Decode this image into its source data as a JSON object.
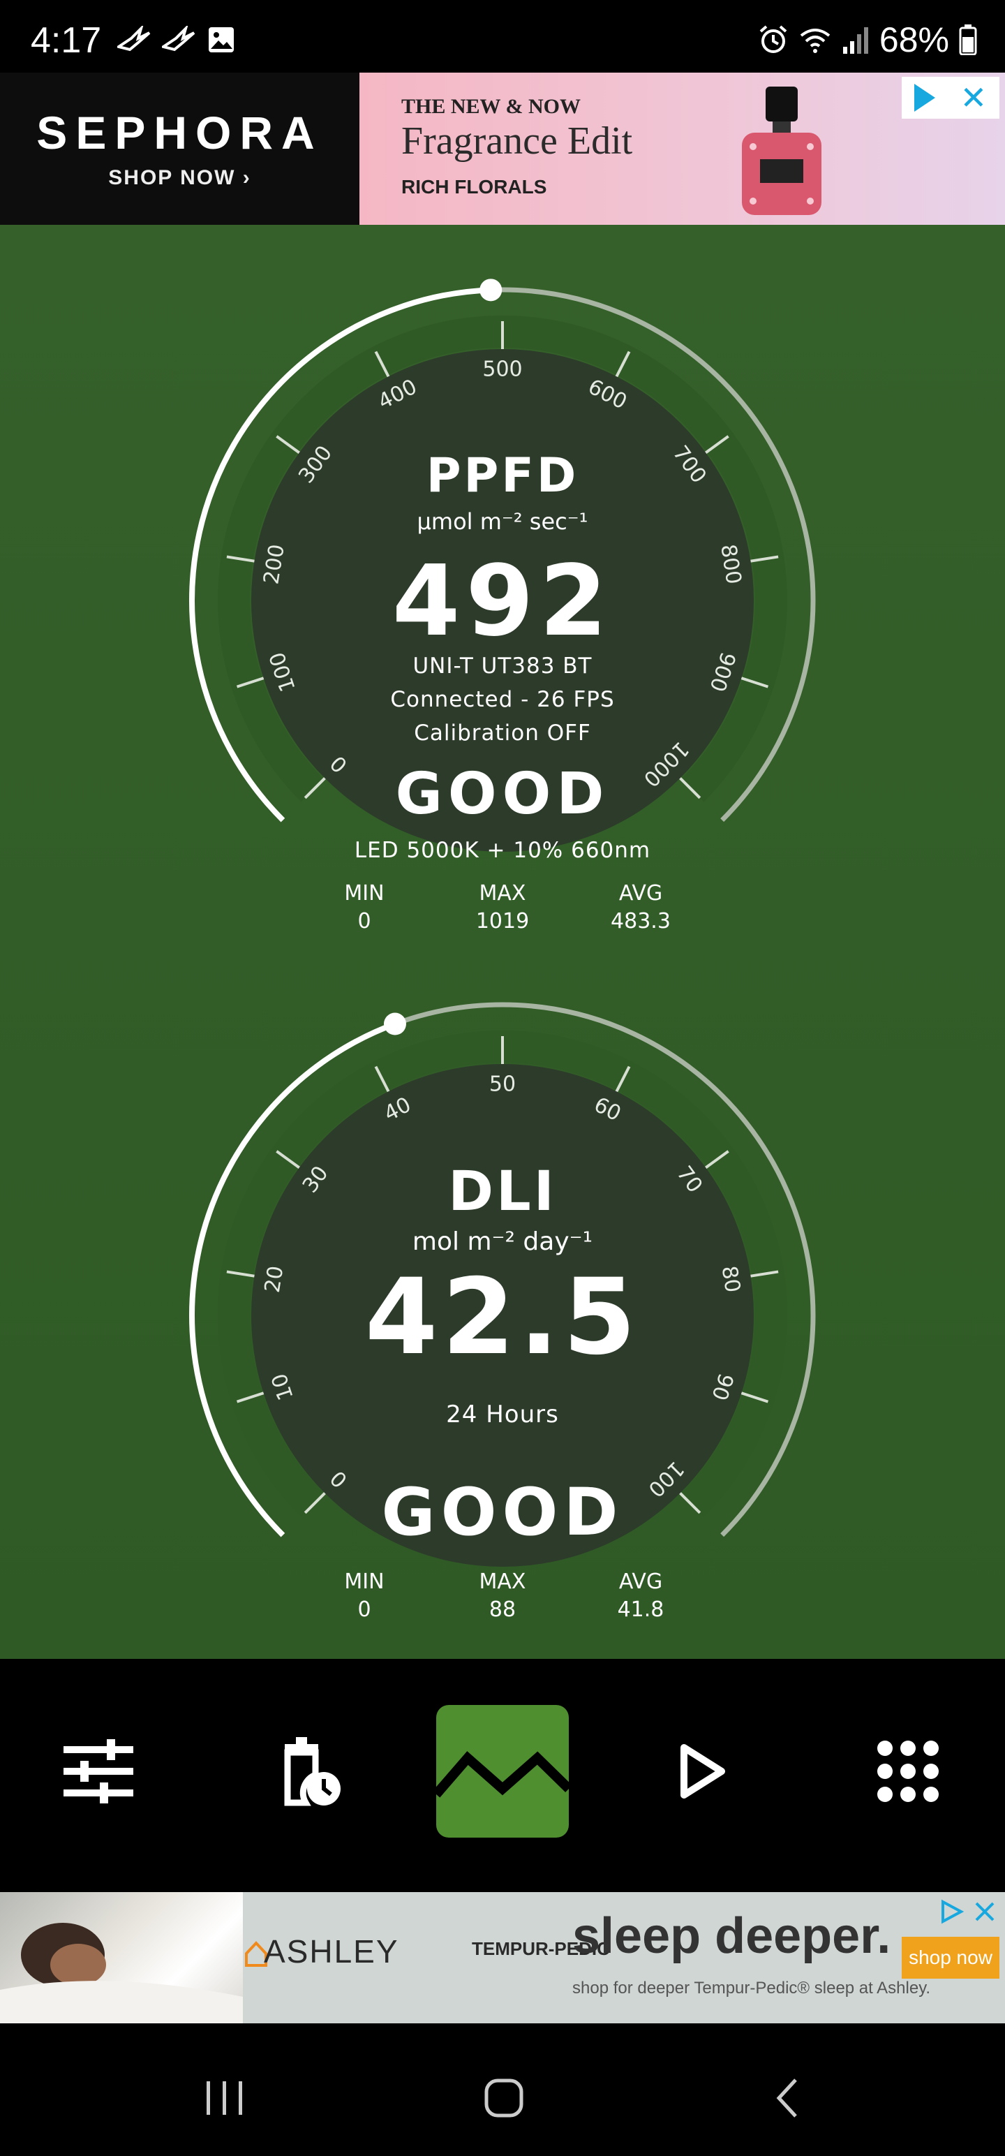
{
  "status": {
    "time": "4:17",
    "battery_percent": "68%",
    "icons_left": [
      "hummingbird-icon",
      "hummingbird-icon",
      "image-icon"
    ],
    "icons_right": [
      "alarm-icon",
      "wifi-icon",
      "signal-icon",
      "battery-icon"
    ]
  },
  "ad_top": {
    "brand": "SEPHORA",
    "cta": "SHOP NOW ›",
    "line1": "THE NEW & NOW",
    "line2": "Fragrance Edit",
    "line3": "RICH FLORALS"
  },
  "ppfd": {
    "title": "PPFD",
    "unit": "μmol m⁻² sec⁻¹",
    "value": "492",
    "device": "UNI-T UT383 BT",
    "connection": "Connected - 26 FPS",
    "calibration": "Calibration OFF",
    "status": "GOOD",
    "light_type": "LED 5000K + 10% 660nm",
    "min_label": "MIN",
    "min_value": "0",
    "max_label": "MAX",
    "max_value": "1019",
    "avg_label": "AVG",
    "avg_value": "483.3",
    "gauge_max": 1000,
    "gauge_value": 492,
    "ticks": [
      "0",
      "100",
      "200",
      "300",
      "400",
      "500",
      "600",
      "700",
      "800",
      "900",
      "1000"
    ]
  },
  "dli": {
    "title": "DLI",
    "unit": "mol m⁻² day⁻¹",
    "value": "42.5",
    "period": "24 Hours",
    "status": "GOOD",
    "min_label": "MIN",
    "min_value": "0",
    "max_label": "MAX",
    "max_value": "88",
    "avg_label": "AVG",
    "avg_value": "41.8",
    "gauge_max": 100,
    "gauge_value": 42.5,
    "ticks": [
      "0",
      "10",
      "20",
      "30",
      "40",
      "50",
      "60",
      "70",
      "80",
      "90",
      "100"
    ]
  },
  "toolbar": {
    "buttons": [
      "sliders-icon",
      "delete-timer-icon",
      "graph-icon",
      "play-icon",
      "grid-menu-icon"
    ],
    "active": "graph-icon"
  },
  "ad_bottom": {
    "brand1": "ASHLEY",
    "brand2": "TEMPUR-PEDIC",
    "headline": "sleep deeper.",
    "sub": "shop for deeper Tempur-Pedic® sleep at Ashley.",
    "cta": "shop now"
  },
  "colors": {
    "background_green": "#35602a",
    "gauge_band": "#2f5a25",
    "gauge_dark": "#2c3b2a",
    "active_button": "#4f8f2f",
    "ad_accent": "#17a8e0"
  }
}
